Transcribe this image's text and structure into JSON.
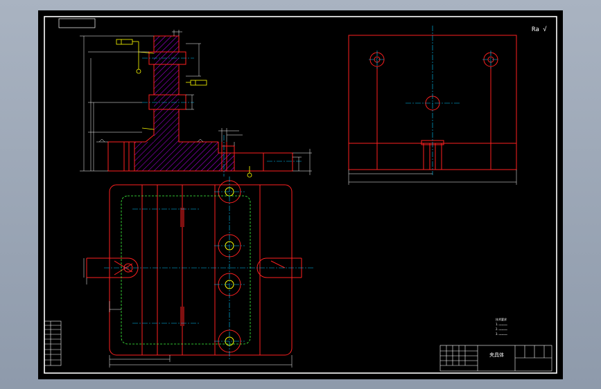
{
  "colors": {
    "background": "#000000",
    "frame": "#ffffff",
    "outline": "#ff2020",
    "center_line": "#00c8ff",
    "hatch": "#c000ff",
    "yellow": "#ffff00",
    "green": "#40ff40",
    "dimension": "#ffffff"
  },
  "drawing": {
    "roughness_symbol": "Ra √",
    "tech_notes": [
      "技术要求",
      "1.……………",
      "2.……………",
      "3.……………"
    ],
    "title_block": {
      "part_name": "夹具体",
      "cells": [
        "",
        "",
        "",
        "",
        "",
        ""
      ]
    }
  }
}
